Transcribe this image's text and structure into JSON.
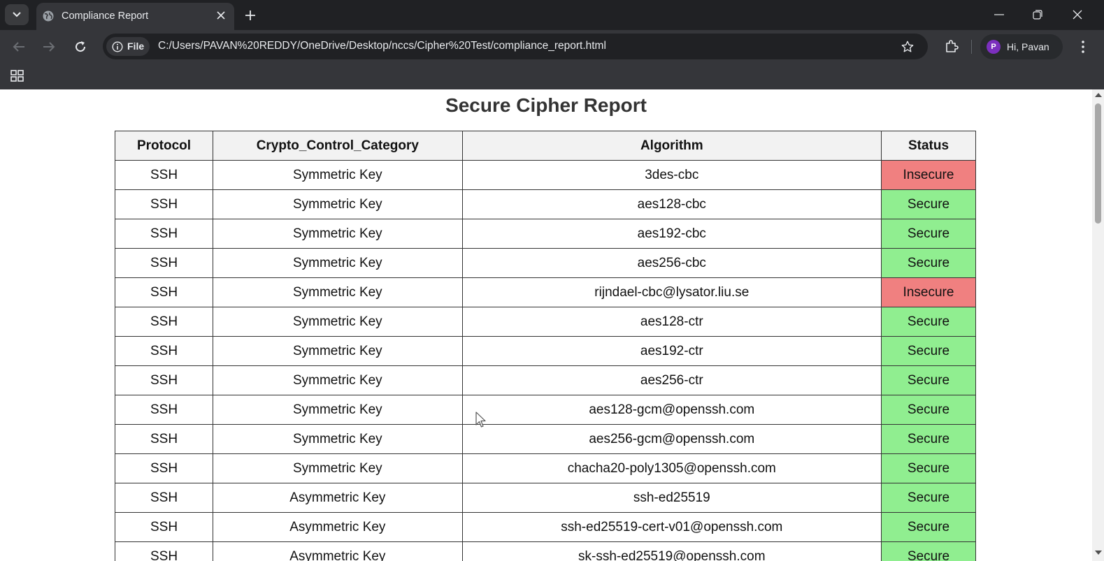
{
  "browser": {
    "tab_title": "Compliance Report",
    "site_chip_label": "File",
    "url": "C:/Users/PAVAN%20REDDY/OneDrive/Desktop/nccs/Cipher%20Test/compliance_report.html",
    "profile_initial": "P",
    "profile_name": "Hi, Pavan",
    "icons": [
      "tab-list-icon",
      "globe-icon",
      "close-icon",
      "plus-icon",
      "minimize-icon",
      "restore-icon",
      "window-close-icon",
      "back-arrow-icon",
      "forward-arrow-icon",
      "reload-icon",
      "info-icon",
      "star-icon",
      "extensions-icon",
      "more-vert-icon",
      "apps-grid-icon"
    ]
  },
  "report": {
    "title": "Secure Cipher Report",
    "columns": [
      "Protocol",
      "Crypto_Control_Category",
      "Algorithm",
      "Status"
    ],
    "rows": [
      {
        "protocol": "SSH",
        "category": "Symmetric Key",
        "algorithm": "3des-cbc",
        "status": "Insecure"
      },
      {
        "protocol": "SSH",
        "category": "Symmetric Key",
        "algorithm": "aes128-cbc",
        "status": "Secure"
      },
      {
        "protocol": "SSH",
        "category": "Symmetric Key",
        "algorithm": "aes192-cbc",
        "status": "Secure"
      },
      {
        "protocol": "SSH",
        "category": "Symmetric Key",
        "algorithm": "aes256-cbc",
        "status": "Secure"
      },
      {
        "protocol": "SSH",
        "category": "Symmetric Key",
        "algorithm": "rijndael-cbc@lysator.liu.se",
        "status": "Insecure"
      },
      {
        "protocol": "SSH",
        "category": "Symmetric Key",
        "algorithm": "aes128-ctr",
        "status": "Secure"
      },
      {
        "protocol": "SSH",
        "category": "Symmetric Key",
        "algorithm": "aes192-ctr",
        "status": "Secure"
      },
      {
        "protocol": "SSH",
        "category": "Symmetric Key",
        "algorithm": "aes256-ctr",
        "status": "Secure"
      },
      {
        "protocol": "SSH",
        "category": "Symmetric Key",
        "algorithm": "aes128-gcm@openssh.com",
        "status": "Secure"
      },
      {
        "protocol": "SSH",
        "category": "Symmetric Key",
        "algorithm": "aes256-gcm@openssh.com",
        "status": "Secure"
      },
      {
        "protocol": "SSH",
        "category": "Symmetric Key",
        "algorithm": "chacha20-poly1305@openssh.com",
        "status": "Secure"
      },
      {
        "protocol": "SSH",
        "category": "Asymmetric Key",
        "algorithm": "ssh-ed25519",
        "status": "Secure"
      },
      {
        "protocol": "SSH",
        "category": "Asymmetric Key",
        "algorithm": "ssh-ed25519-cert-v01@openssh.com",
        "status": "Secure"
      },
      {
        "protocol": "SSH",
        "category": "Asymmetric Key",
        "algorithm": "sk-ssh-ed25519@openssh.com",
        "status": "Secure"
      }
    ],
    "status_colors": {
      "Secure": "#90ee90",
      "Insecure": "#f08080"
    }
  }
}
